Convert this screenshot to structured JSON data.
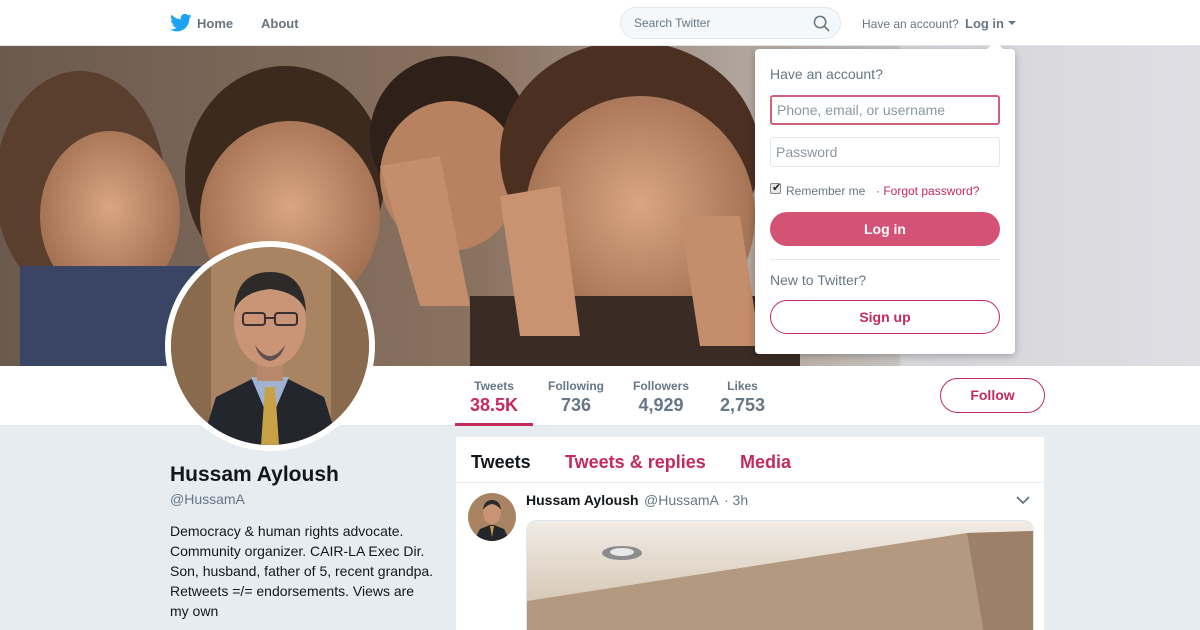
{
  "nav": {
    "logo": "twitter-bird-icon",
    "home_label": "Home",
    "about_label": "About",
    "search_placeholder": "Search Twitter",
    "have_account_label": "Have an account?",
    "login_label": "Log in"
  },
  "profile": {
    "name": "Hussam Ayloush",
    "handle": "@HussamA",
    "bio": "Democracy & human rights advocate. Community organizer. CAIR-LA Exec Dir. Son, husband, father of 5, recent grandpa. Retweets =/= endorsements. Views are my own"
  },
  "stats": [
    {
      "label": "Tweets",
      "value": "38.5K",
      "active": true
    },
    {
      "label": "Following",
      "value": "736",
      "active": false
    },
    {
      "label": "Followers",
      "value": "4,929",
      "active": false
    },
    {
      "label": "Likes",
      "value": "2,753",
      "active": false
    }
  ],
  "follow_label": "Follow",
  "timeline": {
    "tabs": [
      "Tweets",
      "Tweets & replies",
      "Media"
    ],
    "tweet": {
      "author": "Hussam Ayloush",
      "handle": "@HussamA",
      "time": "· 3h"
    }
  },
  "login_dropdown": {
    "title": "Have an account?",
    "username_placeholder": "Phone, email, or username",
    "password_placeholder": "Password",
    "remember_label": "Remember me",
    "forgot_label": "· Forgot password?",
    "login_button": "Log in",
    "new_label": "New to Twitter?",
    "signup_button": "Sign up"
  },
  "colors": {
    "accent": "#c42b5c",
    "twitter_blue": "#1da1f2",
    "muted_text": "#657786",
    "background": "#e6ecf0"
  }
}
